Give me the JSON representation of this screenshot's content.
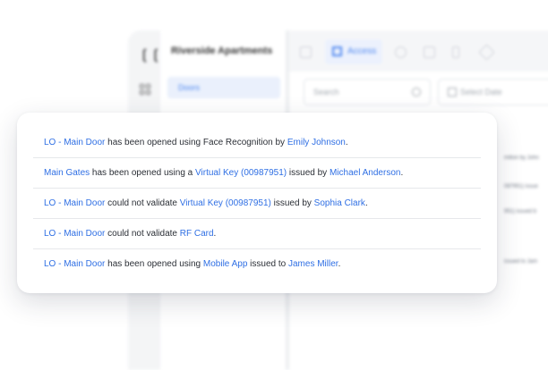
{
  "app": {
    "title": "Riverside Apartments",
    "nav_selected": "Doors",
    "active_tab": "Access",
    "search_placeholder": "Search",
    "date_placeholder": "Select Date",
    "bg_fragments": [
      "mition by John",
      "087951) issue",
      "951) issued b",
      "issued to Jam"
    ]
  },
  "notifications": [
    {
      "parts": [
        {
          "t": "LO - Main Door",
          "link": true
        },
        {
          "t": " has been opened using Face Recognition by ",
          "link": false
        },
        {
          "t": "Emily Johnson",
          "link": true
        },
        {
          "t": ".",
          "link": false
        }
      ]
    },
    {
      "parts": [
        {
          "t": "Main Gates",
          "link": true
        },
        {
          "t": " has been opened using a ",
          "link": false
        },
        {
          "t": "Virtual Key (00987951)",
          "link": true
        },
        {
          "t": " issued by ",
          "link": false
        },
        {
          "t": "Michael Anderson",
          "link": true
        },
        {
          "t": ".",
          "link": false
        }
      ]
    },
    {
      "parts": [
        {
          "t": "LO - Main Door",
          "link": true
        },
        {
          "t": " could not validate ",
          "link": false
        },
        {
          "t": "Virtual Key (00987951)",
          "link": true
        },
        {
          "t": " issued by ",
          "link": false
        },
        {
          "t": "Sophia Clark",
          "link": true
        },
        {
          "t": ".",
          "link": false
        }
      ]
    },
    {
      "parts": [
        {
          "t": "LO - Main Door",
          "link": true
        },
        {
          "t": " could not validate ",
          "link": false
        },
        {
          "t": "RF Card",
          "link": true
        },
        {
          "t": ".",
          "link": false
        }
      ]
    },
    {
      "parts": [
        {
          "t": "LO - Main Door",
          "link": true
        },
        {
          "t": " has been opened using  ",
          "link": false
        },
        {
          "t": "Mobile App",
          "link": true
        },
        {
          "t": " issued to ",
          "link": false
        },
        {
          "t": "James Miller",
          "link": true
        },
        {
          "t": ".",
          "link": false
        }
      ]
    }
  ],
  "colors": {
    "link": "#2f6fe4",
    "accent": "#3d7bf0",
    "text": "#2b2f36"
  }
}
